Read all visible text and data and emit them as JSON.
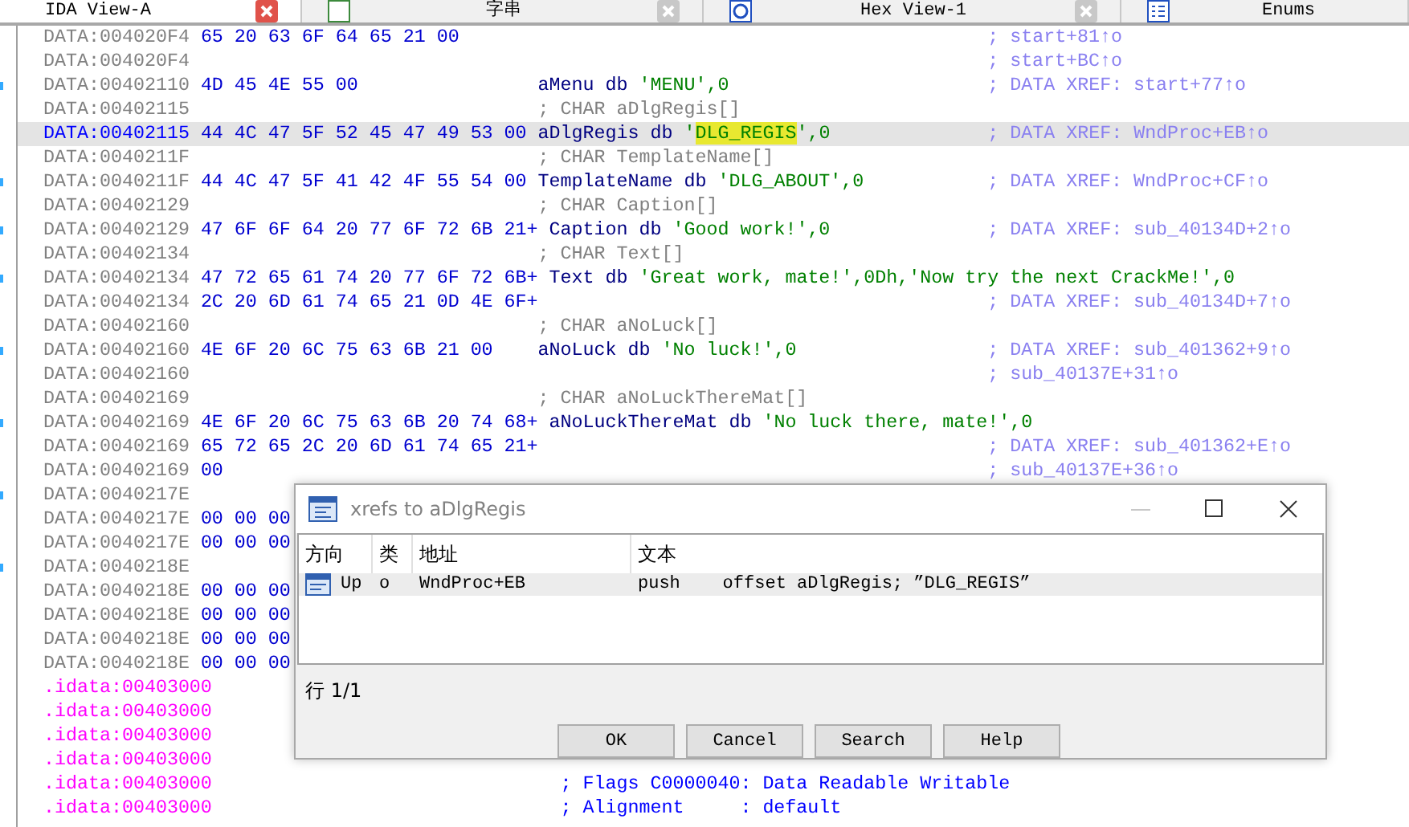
{
  "tabs": [
    {
      "label": "IDA View-A",
      "selected": true
    },
    {
      "label": "字串",
      "selected": false
    },
    {
      "label": "Hex View-1",
      "selected": false
    },
    {
      "label": "Enums",
      "selected": false
    }
  ],
  "listing": [
    {
      "kind": "data",
      "address": "DATA:004020F4",
      "bytes": "65 20 63 6F 64 65 21 00",
      "comment": "; start+81↑o",
      "selected": false,
      "highlight": false,
      "gutter_mark": false
    },
    {
      "kind": "data",
      "address": "DATA:004020F4",
      "comment": "; start+BC↑o",
      "selected": false,
      "highlight": false,
      "gutter_mark": false
    },
    {
      "kind": "data",
      "address": "DATA:00402110",
      "bytes": "4D 45 4E 55 00",
      "code": "aMenu db 'MENU',0",
      "comment": "; DATA XREF: start+77↑o",
      "selected": false,
      "highlight": false,
      "gutter_mark": true
    },
    {
      "kind": "data",
      "address": "DATA:00402115",
      "note": "; CHAR aDlgRegis[]",
      "selected": false,
      "highlight": false,
      "gutter_mark": false
    },
    {
      "kind": "data",
      "address": "DATA:00402115",
      "bytes": "44 4C 47 5F 52 45 47 49 53 00",
      "code": "aDlgRegis db 'DLG_REGIS',0",
      "comment": "; DATA XREF: WndProc+EB↑o",
      "selected": true,
      "highlight": true,
      "gutter_mark": false
    },
    {
      "kind": "data",
      "address": "DATA:0040211F",
      "note": "; CHAR TemplateName[]",
      "selected": false,
      "highlight": false,
      "gutter_mark": false
    },
    {
      "kind": "data",
      "address": "DATA:0040211F",
      "bytes": "44 4C 47 5F 41 42 4F 55 54 00",
      "code": "TemplateName db 'DLG_ABOUT',0",
      "comment": "; DATA XREF: WndProc+CF↑o",
      "selected": false,
      "highlight": false,
      "gutter_mark": true
    },
    {
      "kind": "data",
      "address": "DATA:00402129",
      "note": "; CHAR Caption[]",
      "selected": false,
      "highlight": false,
      "gutter_mark": false
    },
    {
      "kind": "data",
      "address": "DATA:00402129",
      "bytes": "47 6F 6F 64 20 77 6F 72 6B 21+",
      "code": "Caption db 'Good work!',0",
      "comment": "; DATA XREF: sub_40134D+2↑o",
      "selected": false,
      "highlight": false,
      "gutter_mark": true
    },
    {
      "kind": "data",
      "address": "DATA:00402134",
      "note": "; CHAR Text[]",
      "selected": false,
      "highlight": false,
      "gutter_mark": false
    },
    {
      "kind": "data",
      "address": "DATA:00402134",
      "bytes": "47 72 65 61 74 20 77 6F 72 6B+",
      "code": "Text db 'Great work, mate!',0Dh,'Now try the next CrackMe!',0",
      "selected": false,
      "highlight": false,
      "gutter_mark": true
    },
    {
      "kind": "data",
      "address": "DATA:00402134",
      "bytes": "2C 20 6D 61 74 65 21 0D 4E 6F+",
      "comment": "; DATA XREF: sub_40134D+7↑o",
      "selected": false,
      "highlight": false,
      "gutter_mark": false
    },
    {
      "kind": "data",
      "address": "DATA:00402160",
      "note": "; CHAR aNoLuck[]",
      "selected": false,
      "highlight": false,
      "gutter_mark": false
    },
    {
      "kind": "data",
      "address": "DATA:00402160",
      "bytes": "4E 6F 20 6C 75 63 6B 21 00",
      "code": "aNoLuck db 'No luck!',0",
      "comment": "; DATA XREF: sub_401362+9↑o",
      "selected": false,
      "highlight": false,
      "gutter_mark": true
    },
    {
      "kind": "data",
      "address": "DATA:00402160",
      "comment": "; sub_40137E+31↑o",
      "selected": false,
      "highlight": false,
      "gutter_mark": false
    },
    {
      "kind": "data",
      "address": "DATA:00402169",
      "note": "; CHAR aNoLuckThereMat[]",
      "selected": false,
      "highlight": false,
      "gutter_mark": false
    },
    {
      "kind": "data",
      "address": "DATA:00402169",
      "bytes": "4E 6F 20 6C 75 63 6B 20 74 68+",
      "code": "aNoLuckThereMat db 'No luck there, mate!',0",
      "selected": false,
      "highlight": false,
      "gutter_mark": true
    },
    {
      "kind": "data",
      "address": "DATA:00402169",
      "bytes": "65 72 65 2C 20 6D 61 74 65 21+",
      "comment": "; DATA XREF: sub_401362+E↑o",
      "selected": false,
      "highlight": false,
      "gutter_mark": false
    },
    {
      "kind": "data",
      "address": "DATA:00402169",
      "bytes": "00",
      "comment": "; sub_40137E+36↑o",
      "selected": false,
      "highlight": false,
      "gutter_mark": false
    },
    {
      "kind": "data",
      "address": "DATA:0040217E",
      "selected": false,
      "highlight": false,
      "gutter_mark": true
    },
    {
      "kind": "data",
      "address": "DATA:0040217E",
      "bytes": "00 00 00",
      "selected": false,
      "highlight": false,
      "gutter_mark": false
    },
    {
      "kind": "data",
      "address": "DATA:0040217E",
      "bytes": "00 00 00",
      "selected": false,
      "highlight": false,
      "gutter_mark": false
    },
    {
      "kind": "data",
      "address": "DATA:0040218E",
      "selected": false,
      "highlight": false,
      "gutter_mark": true
    },
    {
      "kind": "data",
      "address": "DATA:0040218E",
      "bytes": "00 00 00",
      "selected": false,
      "highlight": false,
      "gutter_mark": false
    },
    {
      "kind": "data",
      "address": "DATA:0040218E",
      "bytes": "00 00 00",
      "selected": false,
      "highlight": false,
      "gutter_mark": false
    },
    {
      "kind": "data",
      "address": "DATA:0040218E",
      "bytes": "00 00 00",
      "selected": false,
      "highlight": false,
      "gutter_mark": false
    },
    {
      "kind": "data",
      "address": "DATA:0040218E",
      "bytes": "00 00 00",
      "selected": false,
      "highlight": false,
      "gutter_mark": false
    },
    {
      "kind": "idata",
      "address": ".idata:00403000",
      "selected": false,
      "highlight": false,
      "gutter_mark": false
    },
    {
      "kind": "idata",
      "address": ".idata:00403000",
      "selected": false,
      "highlight": false,
      "gutter_mark": false
    },
    {
      "kind": "idata",
      "address": ".idata:00403000",
      "selected": false,
      "highlight": false,
      "gutter_mark": false
    },
    {
      "kind": "idata",
      "address": ".idata:00403000",
      "selected": false,
      "highlight": false,
      "gutter_mark": false
    },
    {
      "kind": "idata",
      "address": ".idata:00403000",
      "note": "; Flags C0000040: Data Readable Writable",
      "selected": false,
      "highlight": false,
      "gutter_mark": false
    },
    {
      "kind": "idata",
      "address": ".idata:00403000",
      "note": "; Alignment     : default",
      "selected": false,
      "highlight": false,
      "gutter_mark": false
    }
  ],
  "dialog": {
    "title": "xrefs to aDlgRegis",
    "columns": [
      "方向",
      "类",
      "地址",
      "文本"
    ],
    "rows": [
      {
        "direction": "Up",
        "type": "o",
        "address": "WndProc+EB",
        "text": "push    offset aDlgRegis; ”DLG_REGIS”",
        "selected": true
      }
    ],
    "status": "行 1/1",
    "buttons": [
      "OK",
      "Cancel",
      "Search",
      "Help"
    ]
  }
}
